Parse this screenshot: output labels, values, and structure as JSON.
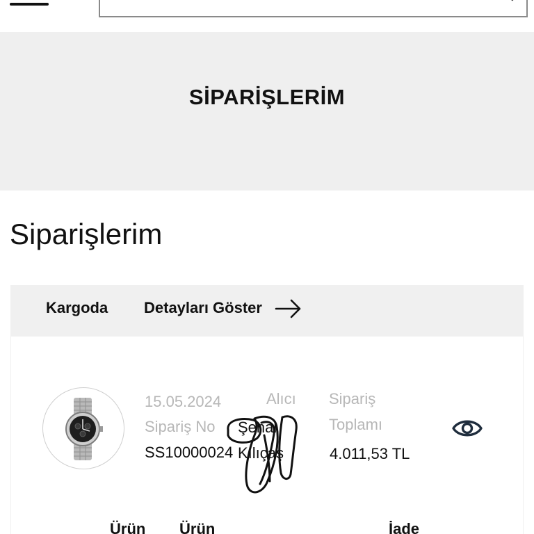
{
  "header": {
    "menu_icon": "hamburger-menu-icon",
    "search": {
      "placeholder": "",
      "icon": "search-icon"
    }
  },
  "banner": {
    "title": "SİPARİŞLERİM"
  },
  "page": {
    "title": "Siparişlerim"
  },
  "order": {
    "status": "Kargoda",
    "details_label": "Detayları Göster",
    "date": "15.05.2024",
    "order_no_label": "Sipariş No",
    "order_no": "SS10000024",
    "recipient_label": "Alıcı",
    "recipient_name": "Şenal",
    "recipient_surname": "Kılıçaş",
    "total_label_line1": "Sipariş",
    "total_label_line2": "Toplamı",
    "total_value": "4.011,53 TL",
    "view_icon": "eye-icon",
    "product_image": "wristwatch"
  },
  "table_headers": [
    "Ürün",
    "Ürün",
    "İade"
  ],
  "colors": {
    "banner_bg": "#efefef",
    "card_head_bg": "#f0f0f0",
    "muted_text": "#b7b7b7",
    "text": "#111111"
  }
}
